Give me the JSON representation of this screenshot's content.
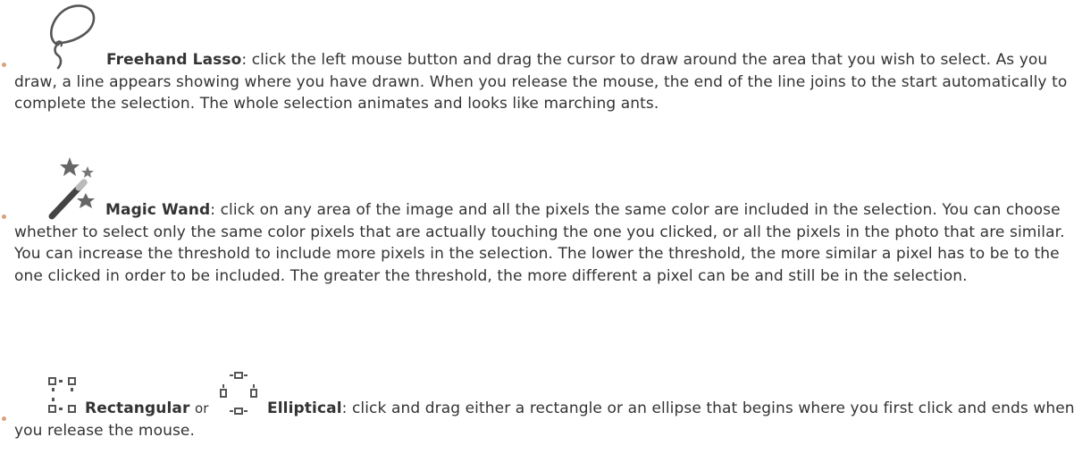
{
  "items": [
    {
      "icon": "lasso-icon",
      "term": "Freehand Lasso",
      "text": ": click the left mouse button and drag the cursor to draw around the area that you wish to select. As you draw, a line appears showing where you have drawn. When you release the mouse, the end of the line joins to the start automatically to complete the selection. The whole selection animates and looks like marching ants."
    },
    {
      "icon": "magic-wand-icon",
      "term": "Magic Wand",
      "text": ": click on any area of the image and all the pixels the same color are included in the selection. You can choose whether to select only the same color pixels that are actually touching the one you clicked, or all the pixels in the photo that are similar. You can increase the threshold to include more pixels in the selection. The lower the threshold, the more similar a pixel has to be to the one clicked in order to be included. The greater the threshold, the more different a pixel can be and still be in the selection."
    },
    {
      "icon": "rectangular-selection-icon",
      "term": "Rectangular",
      "connector": "or",
      "icon2": "elliptical-selection-icon",
      "term2": "Elliptical",
      "text": ": click and drag either a rectangle or an ellipse that begins where you first click and ends when you release the mouse."
    }
  ],
  "colors": {
    "text": "#333333",
    "bullet": "#d9a27a",
    "icon": "#555555"
  }
}
